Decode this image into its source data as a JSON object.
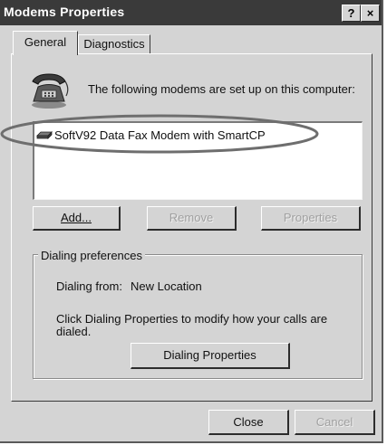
{
  "window": {
    "title": "Modems Properties",
    "help_button": "?",
    "close_button": "×"
  },
  "tabs": [
    {
      "label": "General",
      "selected": true
    },
    {
      "label": "Diagnostics",
      "selected": false
    }
  ],
  "general": {
    "heading": "The following modems are set up on this computer:",
    "icon": "telephone-modem-icon",
    "modems": [
      {
        "name": "SoftV92 Data Fax Modem with SmartCP",
        "icon": "modem-icon"
      }
    ],
    "buttons": {
      "add": {
        "label": "Add...",
        "enabled": true
      },
      "remove": {
        "label": "Remove",
        "enabled": false
      },
      "properties": {
        "label": "Properties",
        "enabled": false
      }
    },
    "dialing_preferences": {
      "legend": "Dialing preferences",
      "from_label": "Dialing from:",
      "from_value": "New Location",
      "description": "Click Dialing Properties to modify how your calls are dialed.",
      "button_label": "Dialing Properties"
    }
  },
  "footer": {
    "close_label": "Close",
    "cancel_label": "Cancel",
    "cancel_enabled": false
  }
}
